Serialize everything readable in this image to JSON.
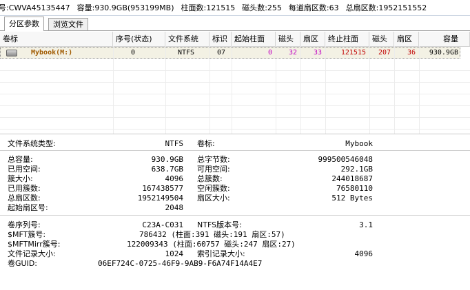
{
  "infobar": {
    "model": "号:CWVA45135447",
    "capacity": "容量:930.9GB(953199MB)",
    "cylinders": "柱面数:121515",
    "heads": "磁头数:255",
    "sectors_per_track": "每道扇区数:63",
    "total_sectors": "总扇区数:1952151552"
  },
  "tabs": [
    {
      "label": "分区参数",
      "active": true
    },
    {
      "label": "浏览文件",
      "active": false
    }
  ],
  "grid": {
    "columns": [
      "卷标",
      "序号(状态)",
      "文件系统",
      "标识",
      "起始柱面",
      "磁头",
      "扇区",
      "终止柱面",
      "磁头",
      "扇区",
      "容量"
    ],
    "row": {
      "label": "Mybook(M:)",
      "index": "0",
      "fs": "NTFS",
      "id": "07",
      "start_cyl": "0",
      "start_head": "32",
      "start_sector": "33",
      "end_cyl": "121515",
      "end_head": "207",
      "end_sector": "36",
      "capacity": "930.9GB"
    }
  },
  "details": {
    "fs_type_label": "文件系统类型:",
    "fs_type_value": "NTFS",
    "volume_label": "卷标:",
    "volume_value": "Mybook",
    "total_capacity_label": "总容量:",
    "total_capacity_value": "930.9GB",
    "total_bytes_label": "总字节数:",
    "total_bytes_value": "999500546048",
    "used_space_label": "已用空间:",
    "used_space_value": "638.7GB",
    "free_space_label": "可用空间:",
    "free_space_value": "292.1GB",
    "cluster_size_label": "簇大小:",
    "cluster_size_value": "4096",
    "total_clusters_label": "总簇数:",
    "total_clusters_value": "244018687",
    "used_clusters_label": "已用簇数:",
    "used_clusters_value": "167438577",
    "free_clusters_label": "空闲簇数:",
    "free_clusters_value": "76580110",
    "total_sectors_label": "总扇区数:",
    "total_sectors_value": "1952149504",
    "sector_size_label": "扇区大小:",
    "sector_size_value": "512 Bytes",
    "start_sector_label": "起始扇区号:",
    "start_sector_value": "2048",
    "serial_label": "卷序列号:",
    "serial_value": "C23A-C031",
    "ntfs_version_label": "NTFS版本号:",
    "ntfs_version_value": "3.1",
    "mft_label": "$MFT簇号:",
    "mft_value": "786432 (柱面:391 磁头:191 扇区:57)",
    "mftmirr_label": "$MFTMirr簇号:",
    "mftmirr_value": "122009343 (柱面:60757 磁头:247 扇区:27)",
    "file_record_label": "文件记录大小:",
    "file_record_value": "1024",
    "index_record_label": "索引记录大小:",
    "index_record_value": "4096",
    "guid_label": "卷GUID:",
    "guid_value": "06EF724C-0725-46F9-9AB9-F6A74F14A4E7"
  }
}
